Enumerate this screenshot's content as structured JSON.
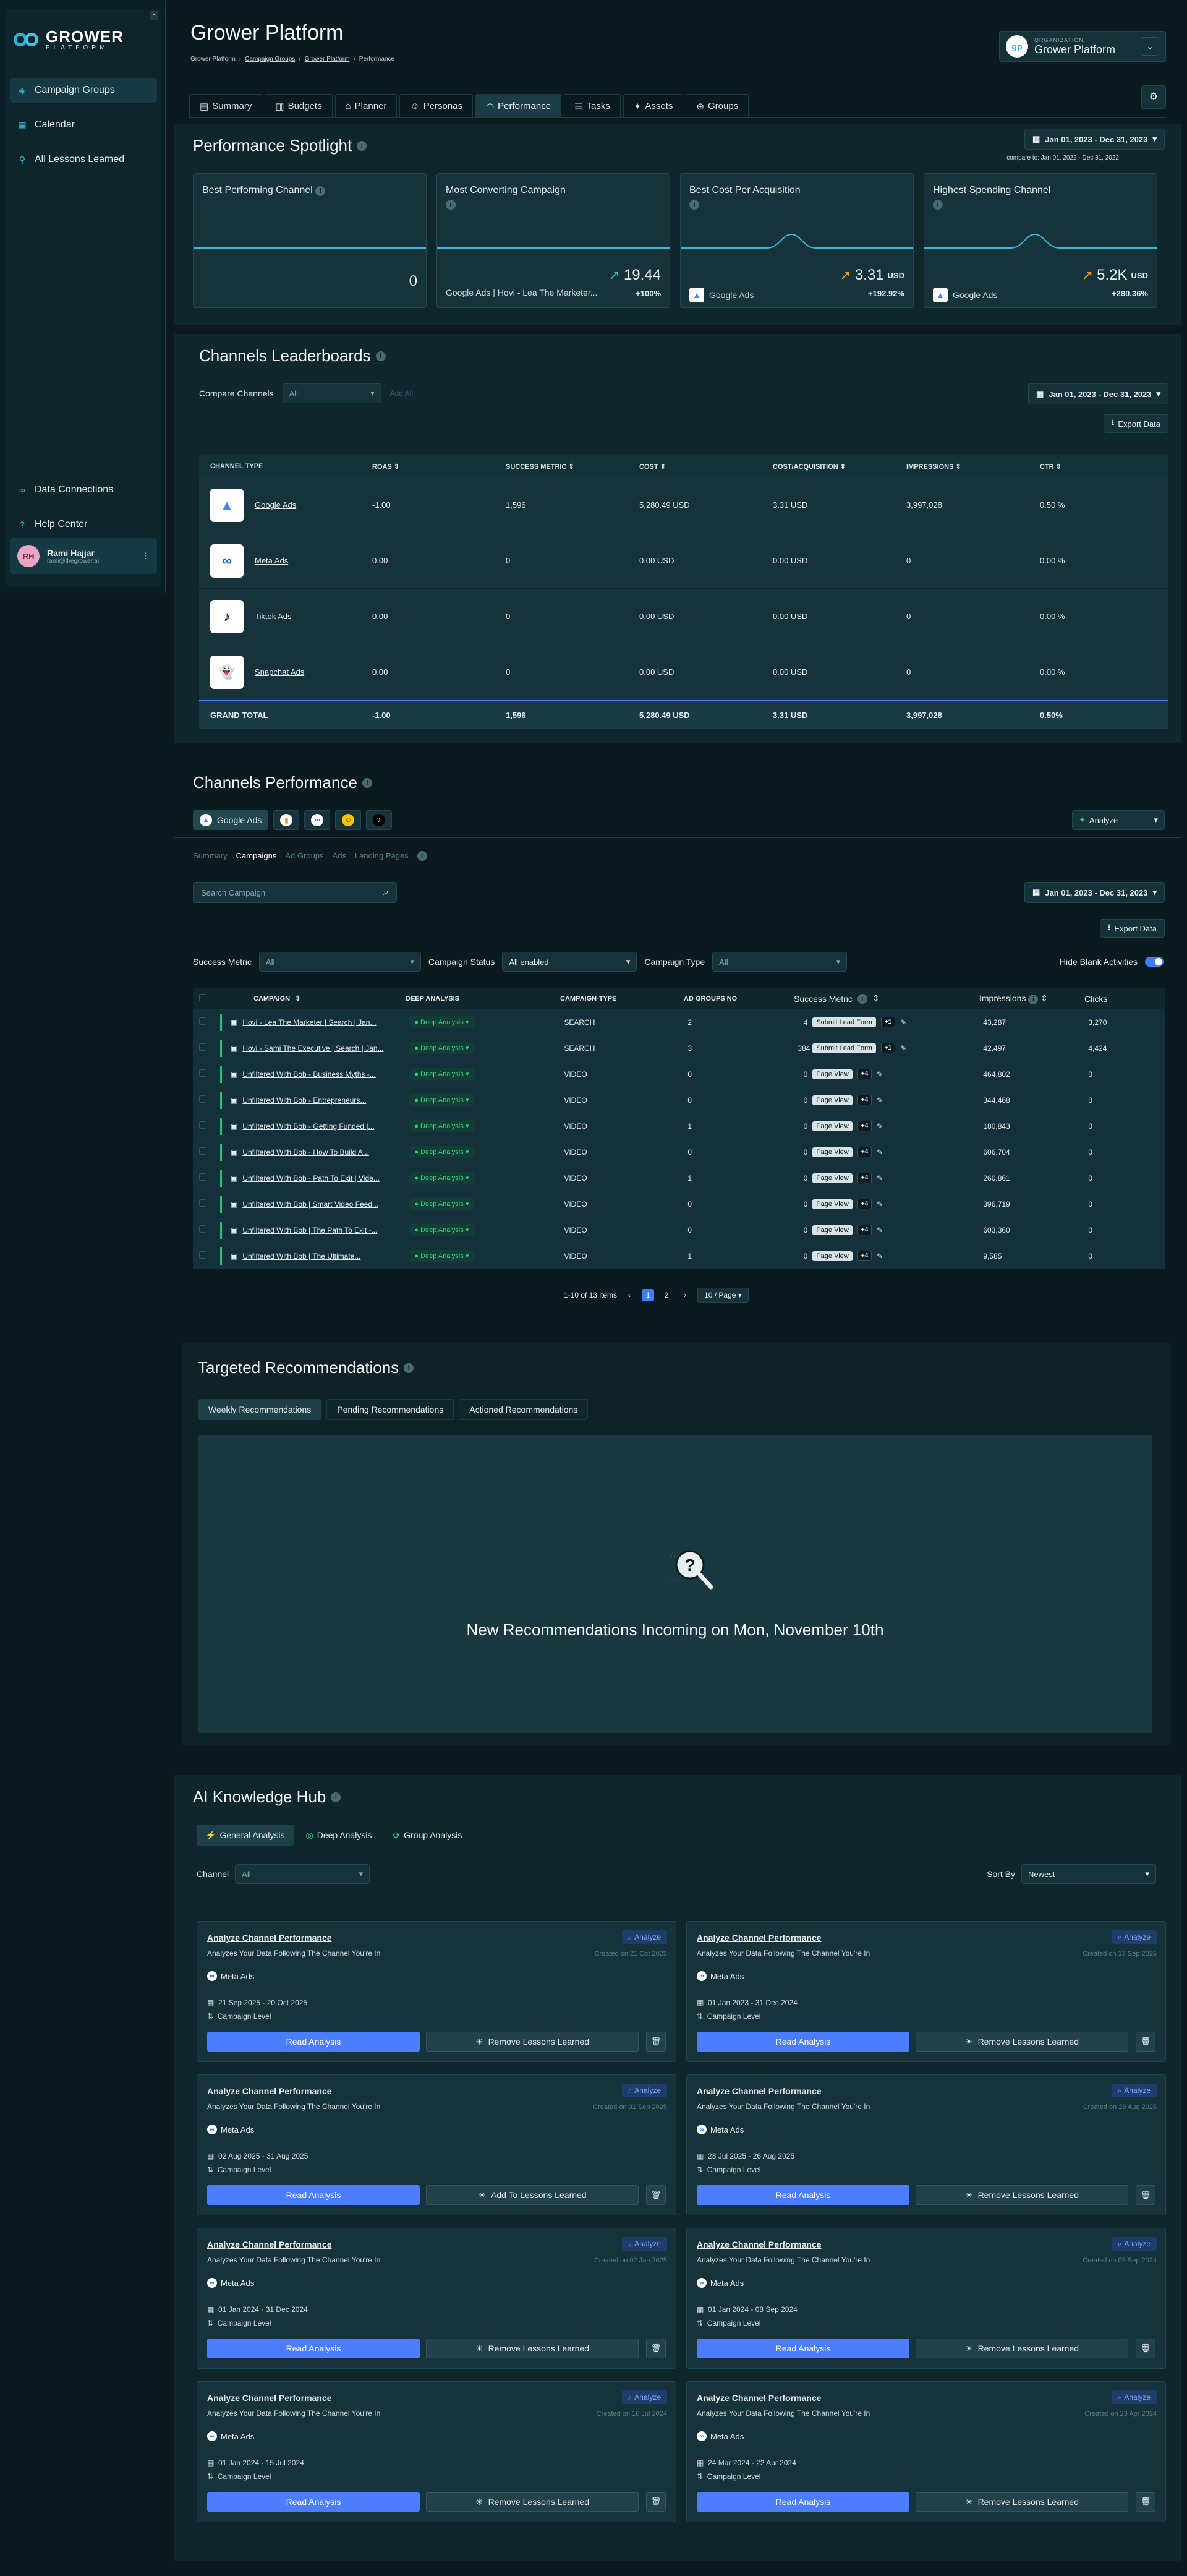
{
  "sidebar": {
    "close": "×",
    "logo_main": "GROWER",
    "logo_sub": "PLATFORM",
    "nav": [
      {
        "label": "Campaign Groups",
        "icon": "layers-icon"
      },
      {
        "label": "Calendar",
        "icon": "calendar-icon"
      },
      {
        "label": "All Lessons Learned",
        "icon": "bulb-icon"
      }
    ],
    "bottom": [
      {
        "label": "Data Connections",
        "icon": "link-icon"
      },
      {
        "label": "Help Center",
        "icon": "help-icon"
      }
    ],
    "user": {
      "initials": "RH",
      "name": "Rami Hajjar",
      "email": "rami@thegrower.ai"
    }
  },
  "header": {
    "title": "Grower Platform",
    "breadcrumb": [
      "Grower Platform",
      "Campaign Groups",
      "Grower Platform",
      "Performance"
    ],
    "org_label": "ORGANIZATION",
    "org_name": "Grower Platform",
    "tabs": [
      "Summary",
      "Budgets",
      "Planner",
      "Personas",
      "Performance",
      "Tasks",
      "Assets",
      "Groups"
    ],
    "active_tab": "Performance"
  },
  "spotlight": {
    "title": "Performance Spotlight",
    "date": "Jan 01, 2023 - Dec 31, 2023",
    "compare": "compare to: Jan 01, 2022 - Dec 31, 2022",
    "cards": [
      {
        "title": "Best Performing Channel",
        "value": "0",
        "sub": "",
        "pct": ""
      },
      {
        "title": "Most Converting Campaign",
        "value": "19.44",
        "sub": "Google Ads | Hovi - Lea The Marketer...",
        "pct": "+100%"
      },
      {
        "title": "Best Cost Per Acquisition",
        "value": "3.31",
        "unit": "USD",
        "sub": "Google Ads",
        "pct": "+192.92%"
      },
      {
        "title": "Highest Spending Channel",
        "value": "5.2K",
        "unit": "USD",
        "sub": "Google Ads",
        "pct": "+280.36%"
      }
    ]
  },
  "leaderboard": {
    "title": "Channels Leaderboards",
    "compare_label": "Compare Channels",
    "compare_value": "All",
    "add_label": "Add All",
    "date": "Jan 01, 2023 - Dec 31, 2023",
    "export": "Export Data",
    "columns": [
      "CHANNEL TYPE",
      "ROAS",
      "SUCCESS METRIC",
      "COST",
      "COST/ACQUISITION",
      "IMPRESSIONS",
      "CTR"
    ],
    "rows": [
      {
        "name": "Google Ads",
        "logo": "▲",
        "color": "#4285f4",
        "roas": "-1.00",
        "sm": "1,596",
        "cost": "5,280.49 USD",
        "cpa": "3.31 USD",
        "imp": "3,997,028",
        "ctr": "0.50 %"
      },
      {
        "name": "Meta Ads",
        "logo": "∞",
        "color": "#0866ff",
        "roas": "0.00",
        "sm": "0",
        "cost": "0.00 USD",
        "cpa": "0.00 USD",
        "imp": "0",
        "ctr": "0.00 %"
      },
      {
        "name": "Tiktok Ads",
        "logo": "♪",
        "color": "#000000",
        "roas": "0.00",
        "sm": "0",
        "cost": "0.00 USD",
        "cpa": "0.00 USD",
        "imp": "0",
        "ctr": "0.00 %"
      },
      {
        "name": "Snapchat Ads",
        "logo": "👻",
        "color": "#f5c400",
        "roas": "0.00",
        "sm": "0",
        "cost": "0.00 USD",
        "cpa": "0.00 USD",
        "imp": "0",
        "ctr": "0.00 %"
      }
    ],
    "total": {
      "name": "GRAND TOTAL",
      "roas": "-1.00",
      "sm": "1,596",
      "cost": "5,280.49 USD",
      "cpa": "3.31 USD",
      "imp": "3,997,028",
      "ctr": "0.50%"
    }
  },
  "performance": {
    "title": "Channels Performance",
    "channel_tab": "Google Ads",
    "analyze": "Analyze",
    "sub_tabs": [
      "Summary",
      "Campaigns",
      "Ad Groups",
      "Ads",
      "Landing Pages"
    ],
    "search_placeholder": "Search Campaign",
    "date": "Jan 01, 2023 - Dec 31, 2023",
    "export": "Export Data",
    "filters": {
      "success_label": "Success Metric",
      "success_value": "All",
      "status_label": "Campaign Status",
      "status_value": "All enabled",
      "type_label": "Campaign Type",
      "type_value": "All",
      "hide_label": "Hide Blank Activities"
    },
    "columns": [
      "CAMPAIGN",
      "DEEP ANALYSIS",
      "CAMPAIGN-TYPE",
      "AD GROUPS NO",
      "Success Metric",
      "Impressions",
      "Clicks"
    ],
    "deep_label": "Deep Analysis",
    "rows": [
      {
        "name": "Hovi - Lea The Marketer | Search | Jan...",
        "type": "SEARCH",
        "ag": "2",
        "smn": "4",
        "sml": "Submit Lead Form",
        "plus": "+1",
        "imp": "43,287",
        "clk": "3,270"
      },
      {
        "name": "Hovi - Sami The Executive | Search | Jan...",
        "type": "SEARCH",
        "ag": "3",
        "smn": "384",
        "sml": "Submit Lead Form",
        "plus": "+1",
        "imp": "42,497",
        "clk": "4,424"
      },
      {
        "name": "Unfiltered With Bob - Business Myths -...",
        "type": "VIDEO",
        "ag": "0",
        "smn": "0",
        "sml": "Page View",
        "plus": "+4",
        "imp": "464,802",
        "clk": "0"
      },
      {
        "name": "Unfiltered With Bob - Entrepreneurs...",
        "type": "VIDEO",
        "ag": "0",
        "smn": "0",
        "sml": "Page View",
        "plus": "+4",
        "imp": "344,468",
        "clk": "0"
      },
      {
        "name": "Unfiltered With Bob - Getting Funded |...",
        "type": "VIDEO",
        "ag": "1",
        "smn": "0",
        "sml": "Page View",
        "plus": "+4",
        "imp": "180,843",
        "clk": "0"
      },
      {
        "name": "Unfiltered With Bob - How To Build A...",
        "type": "VIDEO",
        "ag": "0",
        "smn": "0",
        "sml": "Page View",
        "plus": "+4",
        "imp": "606,704",
        "clk": "0"
      },
      {
        "name": "Unfiltered With Bob - Path To Exit | Vide...",
        "type": "VIDEO",
        "ag": "1",
        "smn": "0",
        "sml": "Page View",
        "plus": "+4",
        "imp": "260,861",
        "clk": "0"
      },
      {
        "name": "Unfiltered With Bob | Smart Video Feed...",
        "type": "VIDEO",
        "ag": "0",
        "smn": "0",
        "sml": "Page View",
        "plus": "+4",
        "imp": "396,719",
        "clk": "0"
      },
      {
        "name": "Unfiltered With Bob | The Path To Exit -...",
        "type": "VIDEO",
        "ag": "0",
        "smn": "0",
        "sml": "Page View",
        "plus": "+4",
        "imp": "603,360",
        "clk": "0"
      },
      {
        "name": "Unfiltered With Bob | The Ultimate...",
        "type": "VIDEO",
        "ag": "1",
        "smn": "0",
        "sml": "Page View",
        "plus": "+4",
        "imp": "9,585",
        "clk": "0"
      }
    ],
    "pager": {
      "summary": "1-10 of 13 items",
      "pages": [
        "1",
        "2"
      ],
      "size": "10 / Page"
    }
  },
  "recommendations": {
    "title": "Targeted Recommendations",
    "tabs": [
      "Weekly Recommendations",
      "Pending Recommendations",
      "Actioned Recommendations"
    ],
    "message": "New Recommendations Incoming on Mon, November 10th"
  },
  "hub": {
    "title": "AI Knowledge Hub",
    "tabs": [
      "General Analysis",
      "Deep Analysis",
      "Group Analysis"
    ],
    "channel_label": "Channel",
    "channel_value": "All",
    "sort_label": "Sort By",
    "sort_value": "Newest",
    "card_title": "Analyze Channel Performance",
    "card_desc": "Analyzes Your Data Following The Channel You're In",
    "analyze": "Analyze",
    "level": "Campaign Level",
    "read": "Read Analysis",
    "cards": [
      {
        "created": "Created on 21 Oct 2025",
        "channel": "Meta Ads",
        "dates": "21 Sep 2025 - 20 Oct 2025",
        "lesson": "Remove Lessons Learned"
      },
      {
        "created": "Created on 17 Sep 2025",
        "channel": "Meta Ads",
        "dates": "01 Jan 2023 - 31 Dec 2024",
        "lesson": "Remove Lessons Learned"
      },
      {
        "created": "Created on 01 Sep 2025",
        "channel": "Meta Ads",
        "dates": "02 Aug 2025 - 31 Aug 2025",
        "lesson": "Add To Lessons Learned"
      },
      {
        "created": "Created on 28 Aug 2025",
        "channel": "Meta Ads",
        "dates": "28 Jul 2025 - 26 Aug 2025",
        "lesson": "Remove Lessons Learned"
      },
      {
        "created": "Created on 02 Jan 2025",
        "channel": "Meta Ads",
        "dates": "01 Jan 2024 - 31 Dec 2024",
        "lesson": "Remove Lessons Learned"
      },
      {
        "created": "Created on 09 Sep 2024",
        "channel": "Meta Ads",
        "dates": "01 Jan 2024 - 08 Sep 2024",
        "lesson": "Remove Lessons Learned"
      },
      {
        "created": "Created on 16 Jul 2024",
        "channel": "Meta Ads",
        "dates": "01 Jan 2024 - 15 Jul 2024",
        "lesson": "Remove Lessons Learned"
      },
      {
        "created": "Created on 23 Apr 2024",
        "channel": "Meta Ads",
        "dates": "24 Mar 2024 - 22 Apr 2024",
        "lesson": "Remove Lessons Learned"
      }
    ]
  }
}
